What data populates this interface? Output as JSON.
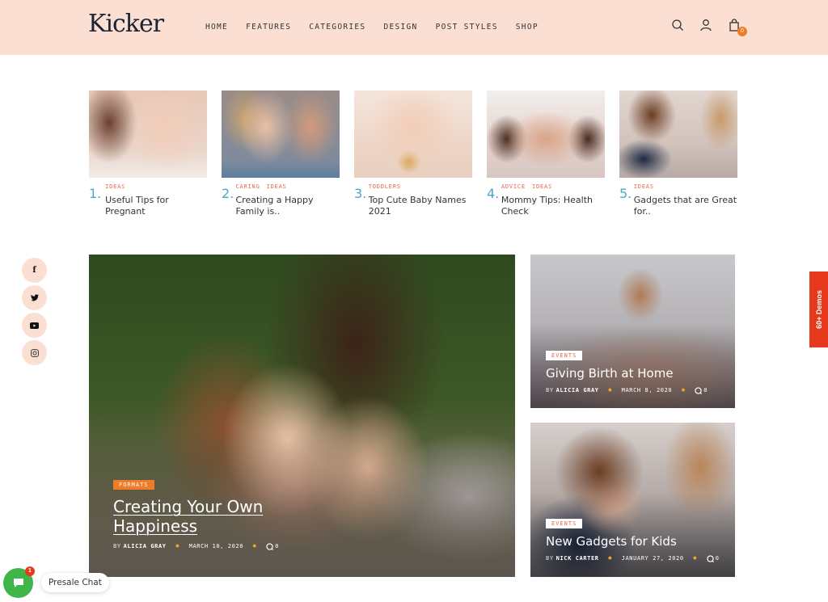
{
  "header": {
    "logo": "Kicker",
    "nav": [
      "HOME",
      "FEATURES",
      "CATEGORIES",
      "DESIGN",
      "POST STYLES",
      "SHOP"
    ],
    "cart_count": "0",
    "bg_color": "#fcdfd3"
  },
  "top_posts": [
    {
      "num": "1.",
      "cats": [
        "IDEAS"
      ],
      "title": "Useful Tips for Pregnant"
    },
    {
      "num": "2.",
      "cats": [
        "CARING",
        "IDEAS"
      ],
      "title": "Creating a Happy Family is.."
    },
    {
      "num": "3.",
      "cats": [
        "TODDLERS"
      ],
      "title": "Top Cute Baby Names 2021"
    },
    {
      "num": "4.",
      "cats": [
        "ADVICE",
        "IDEAS"
      ],
      "title": "Mommy Tips: Health Check"
    },
    {
      "num": "5.",
      "cats": [
        "IDEAS"
      ],
      "title": "Gadgets that are Great for.."
    }
  ],
  "social": [
    "facebook",
    "twitter",
    "youtube",
    "instagram"
  ],
  "featured": {
    "badge": "FORMATS",
    "title_line1": "Creating Your Own",
    "title_line2": "Happiness",
    "by": "BY",
    "author": "ALICIA GRAY",
    "date": "MARCH 10, 2020",
    "comments": "0"
  },
  "side_posts": [
    {
      "badge": "EVENTS",
      "title": "Giving Birth at Home",
      "by": "BY",
      "author": "ALICIA GRAY",
      "date": "MARCH 8, 2020",
      "comments": "0"
    },
    {
      "badge": "EVENTS",
      "title": "New Gadgets for Kids",
      "by": "BY",
      "author": "NICK CARTER",
      "date": "JANUARY 27, 2020",
      "comments": "0"
    }
  ],
  "demos_label": "60+ Demos",
  "chat": {
    "label": "Presale Chat",
    "count": "1"
  },
  "colors": {
    "accent_orange": "#f07c2a",
    "accent_red": "#e6391d",
    "number_blue": "#4aa8c4",
    "chat_green": "#3fb54a"
  }
}
